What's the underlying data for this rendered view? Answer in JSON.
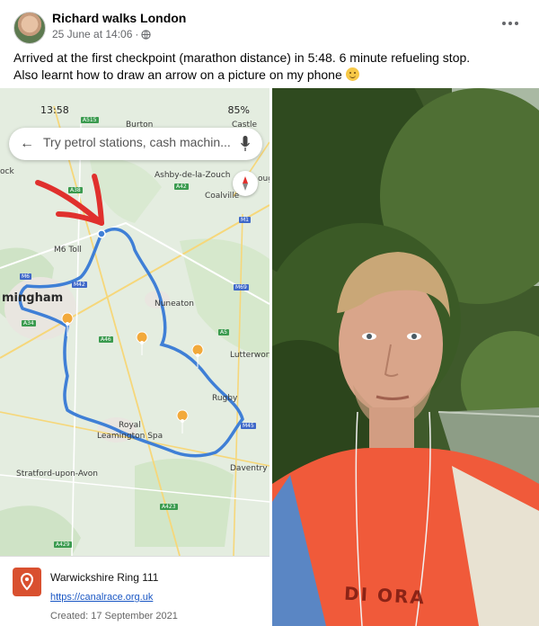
{
  "post": {
    "author": "Richard walks London",
    "date": "25 June at 14:06",
    "separator": "·",
    "text_line1": "Arrived at the first checkpoint (marathon distance) in 5:48. 6 minute refueling stop.",
    "text_line2": "Also learnt how to draw an arrow on a picture on my phone",
    "icons": [
      "globe-icon",
      "more-icon",
      "smile-emoji"
    ]
  },
  "map_screenshot": {
    "status_time": "13:58",
    "status_right": "85%",
    "search_placeholder": "Try petrol stations, cash machin...",
    "labels": {
      "burton": "Burton",
      "castle": "Castle",
      "ashby": "Ashby-de-la-Zouch",
      "coalville": "Coalville",
      "mingham": "mingham",
      "nuneaton": "Nuneaton",
      "lutterworth": "Lutterwort",
      "rugby": "Rugby",
      "royal": "Royal",
      "leamington": "Leamington Spa",
      "stratford": "Stratford-upon-Avon",
      "daventry": "Daventry",
      "ock": "ock",
      "oug": "oug",
      "m6toll": "M6 Toll"
    },
    "roads": {
      "a515": "A515",
      "a38": "A38",
      "a42": "A42",
      "m1": "M1",
      "m6": "M6",
      "m42": "M42",
      "m69": "M69",
      "a34": "A34",
      "a46": "A46",
      "a5": "A5",
      "m45": "M45",
      "a423": "A423",
      "a429": "A429"
    },
    "card": {
      "name": "Warwickshire Ring 111",
      "link": "https://canalrace.org.uk",
      "created": "Created: 17 September 2021"
    },
    "colors": {
      "route": "#3f7fd6",
      "arrow": "#e0302d",
      "pin": "#f2a93b"
    }
  },
  "selfie": {
    "shirt_text": "DI  ORA"
  }
}
